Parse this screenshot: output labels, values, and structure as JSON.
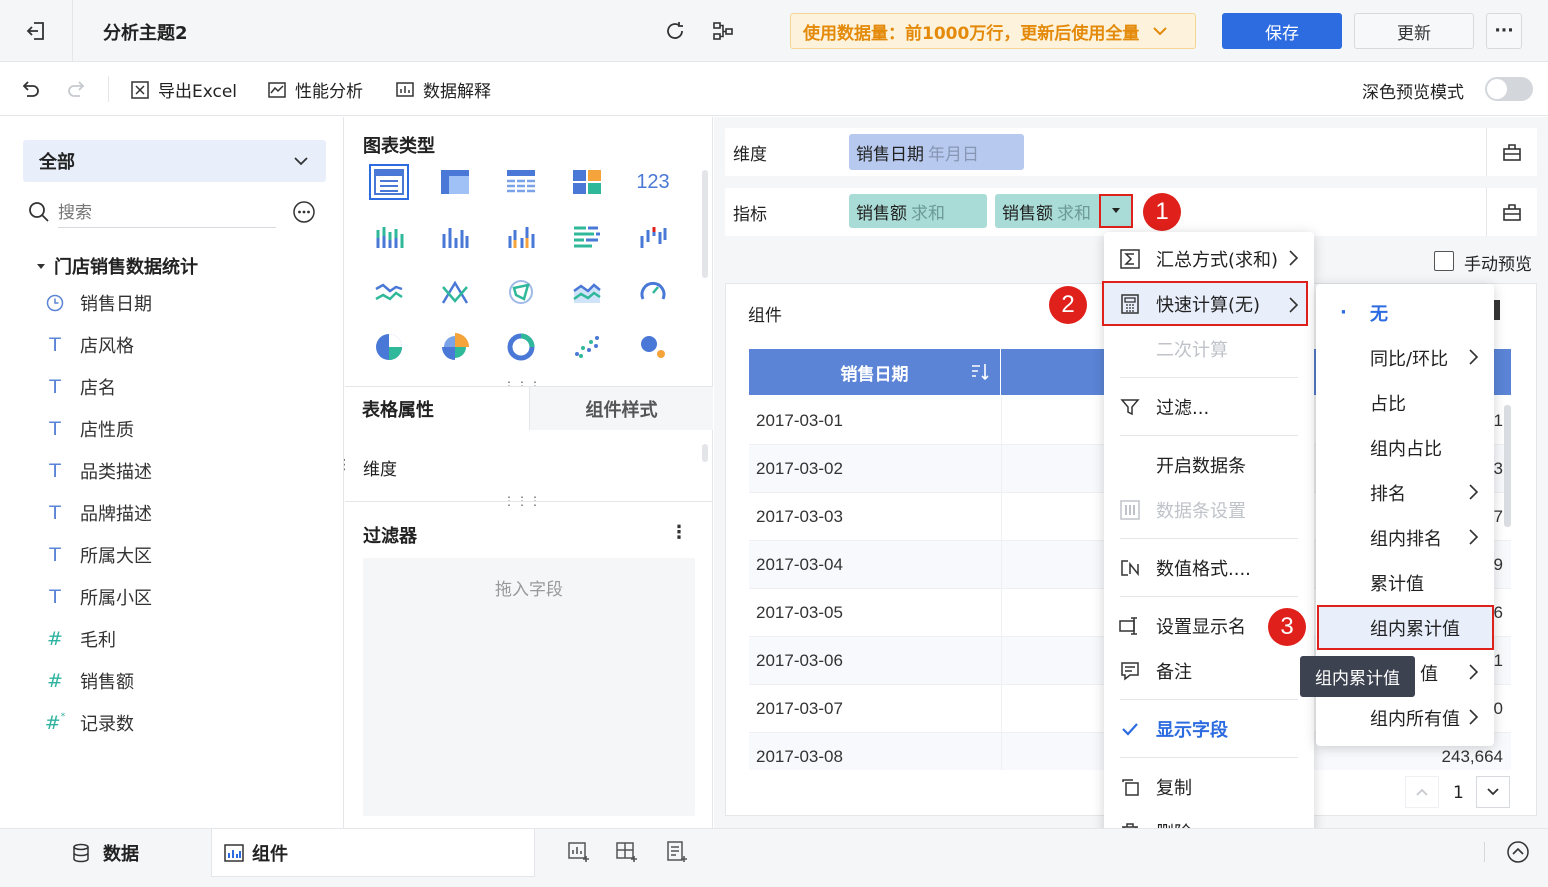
{
  "header": {
    "title": "分析主题2",
    "data_notice": "使用数据量：前1000万行，更新后使用全量",
    "save_label": "保存",
    "update_label": "更新",
    "more_label": "···"
  },
  "toolbar": {
    "export_label": "导出Excel",
    "performance_label": "性能分析",
    "explain_label": "数据解释",
    "dark_preview_label": "深色预览模式"
  },
  "left_panel": {
    "scope_label": "全部",
    "search_placeholder": "搜索",
    "dataset_name": "门店销售数据统计",
    "fields": [
      {
        "label": "销售日期",
        "icon": "clock-icon"
      },
      {
        "label": "店风格",
        "icon": "text-icon"
      },
      {
        "label": "店名",
        "icon": "text-icon"
      },
      {
        "label": "店性质",
        "icon": "text-icon"
      },
      {
        "label": "品类描述",
        "icon": "text-icon"
      },
      {
        "label": "品牌描述",
        "icon": "text-icon"
      },
      {
        "label": "所属大区",
        "icon": "text-icon"
      },
      {
        "label": "所属小区",
        "icon": "text-icon"
      },
      {
        "label": "毛利",
        "icon": "number-icon"
      },
      {
        "label": "销售额",
        "icon": "number-icon"
      },
      {
        "label": "记录数",
        "icon": "number-star-icon"
      }
    ]
  },
  "middle_panel": {
    "chart_type_title": "图表类型",
    "tab_table_props": "表格属性",
    "tab_component_style": "组件样式",
    "dimension_label": "维度",
    "filter_title": "过滤器",
    "filter_placeholder": "拖入字段"
  },
  "right_panel": {
    "dimension_label": "维度",
    "dimension_pill": {
      "name": "销售日期",
      "sub": "年月日"
    },
    "measure_label": "指标",
    "measure_pills": [
      {
        "name": "销售额",
        "sub": "求和"
      },
      {
        "name": "销售额",
        "sub": "求和"
      }
    ],
    "manual_preview_label": "手动预览",
    "component_label": "组件",
    "table_header": "销售日期",
    "rows": [
      {
        "date": "2017-03-01",
        "value": "1"
      },
      {
        "date": "2017-03-02",
        "value": "3"
      },
      {
        "date": "2017-03-03",
        "value": "7"
      },
      {
        "date": "2017-03-04",
        "value": "9"
      },
      {
        "date": "2017-03-05",
        "value": "6"
      },
      {
        "date": "2017-03-06",
        "value": "1"
      },
      {
        "date": "2017-03-07",
        "value": "0"
      },
      {
        "date": "2017-03-08",
        "value": "243,664"
      }
    ],
    "page_number": "1"
  },
  "context_menu": {
    "items": [
      {
        "label": "汇总方式(求和)"
      },
      {
        "label": "快速计算(无)"
      },
      {
        "label": "二次计算"
      },
      {
        "label": "过滤..."
      },
      {
        "label": "开启数据条"
      },
      {
        "label": "数据条设置"
      },
      {
        "label": "数值格式...."
      },
      {
        "label": "设置显示名"
      },
      {
        "label": "备注"
      },
      {
        "label": "显示字段"
      },
      {
        "label": "复制"
      },
      {
        "label": "删除"
      }
    ]
  },
  "submenu": {
    "items": [
      {
        "label": "无"
      },
      {
        "label": "同比/环比"
      },
      {
        "label": "占比"
      },
      {
        "label": "组内占比"
      },
      {
        "label": "排名"
      },
      {
        "label": "组内排名"
      },
      {
        "label": "累计值"
      },
      {
        "label": "组内累计值"
      },
      {
        "label": "值"
      },
      {
        "label": "组内所有值"
      }
    ],
    "tooltip": "组内累计值"
  },
  "annotations": {
    "badge1": "1",
    "badge2": "2",
    "badge3": "3"
  },
  "bottom_bar": {
    "data_tab": "数据",
    "component_tab": "组件"
  },
  "colors": {
    "primary": "#2d6be0",
    "header_blue": "#5b84d6",
    "dim_pill": "#b7c9ee",
    "measure_pill": "#a9dcd6",
    "notice_bg": "#fdf3dc",
    "notice_text": "#e48a0b",
    "annotation_red": "#e0201a"
  }
}
